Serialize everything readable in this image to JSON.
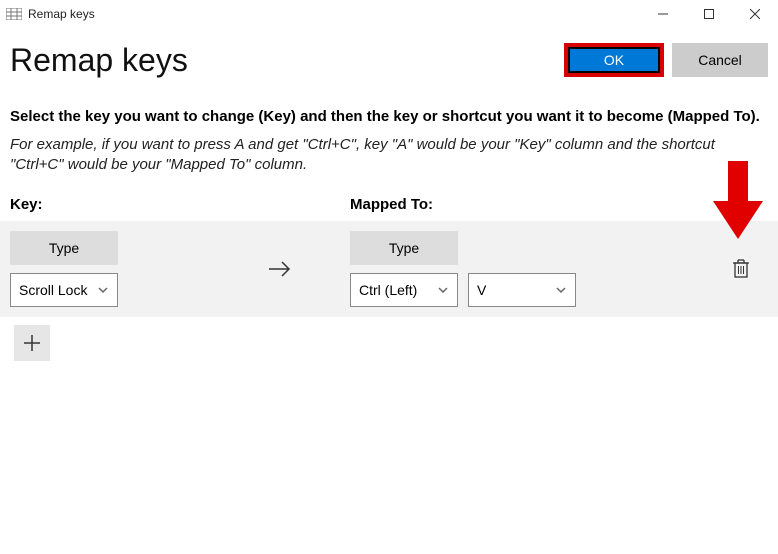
{
  "window": {
    "title": "Remap keys"
  },
  "header": {
    "page_title": "Remap keys",
    "ok_label": "OK",
    "cancel_label": "Cancel"
  },
  "instructions": {
    "bold": "Select the key you want to change (Key) and then the key or shortcut you want it to become (Mapped To).",
    "italic": "For example, if you want to press A and get \"Ctrl+C\", key \"A\" would be your \"Key\" column and the shortcut \"Ctrl+C\" would be your \"Mapped To\" column."
  },
  "columns": {
    "key_label": "Key:",
    "mapped_label": "Mapped To:"
  },
  "row": {
    "type_label": "Type",
    "key_dropdown": "Scroll Lock",
    "mapped_dropdown_1": "Ctrl (Left)",
    "mapped_dropdown_2": "V"
  }
}
